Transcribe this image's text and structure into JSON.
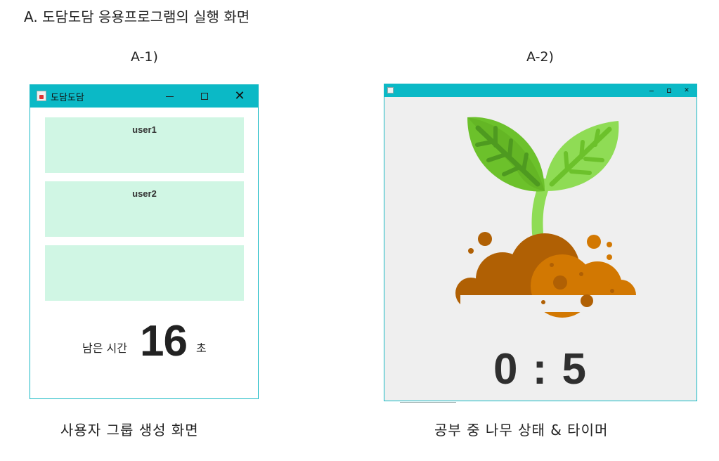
{
  "heading": "A. 도담도담 응용프로그램의 실행 화면",
  "labels": {
    "left": "A-1)",
    "right": "A-2)"
  },
  "window1": {
    "title": "도담도담",
    "user_panels": [
      "user1",
      "user2",
      ""
    ],
    "remaining_label": "남은 시간",
    "remaining_value": "16",
    "remaining_unit": "초",
    "caption": "사용자 그룹 생성 화면"
  },
  "window2": {
    "timer": "0 : 5",
    "caption": "공부 중 나무 상태 & 타이머",
    "illustration": "sprout-in-soil",
    "colors": {
      "leaf_dark": "#6cc12b",
      "leaf_light": "#8fdc55",
      "vein": "#4e9a20",
      "soil_dark": "#b06004",
      "soil_light": "#d27802"
    }
  },
  "colors": {
    "titlebar": "#0bb9c6",
    "panel": "#d0f6e4"
  }
}
